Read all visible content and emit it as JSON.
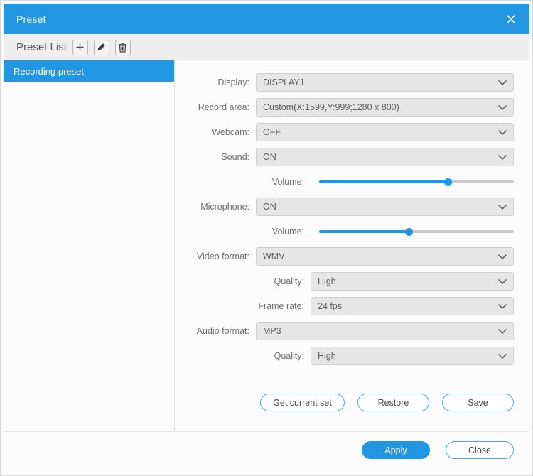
{
  "window": {
    "title": "Preset",
    "close_icon": "close-icon"
  },
  "list_header": {
    "title": "Preset List",
    "tools": [
      {
        "name": "add-preset-button",
        "icon": "plus-icon"
      },
      {
        "name": "edit-preset-button",
        "icon": "pencil-icon"
      },
      {
        "name": "delete-preset-button",
        "icon": "trash-icon"
      }
    ]
  },
  "sidebar": {
    "items": [
      {
        "label": "Recording preset",
        "selected": true
      }
    ]
  },
  "form": {
    "fields": [
      {
        "label": "Display:",
        "value": "DISPLAY1",
        "type": "select",
        "indent": false
      },
      {
        "label": "Record area:",
        "value": "Custom(X:1599,Y:999;1280 x 800)",
        "type": "select",
        "indent": false
      },
      {
        "label": "Webcam:",
        "value": "OFF",
        "type": "select",
        "indent": false
      },
      {
        "label": "Sound:",
        "value": "ON",
        "type": "select",
        "indent": false
      },
      {
        "label": "Volume:",
        "value": 66,
        "type": "slider",
        "indent": true
      },
      {
        "label": "Microphone:",
        "value": "ON",
        "type": "select",
        "indent": false
      },
      {
        "label": "Volume:",
        "value": 46,
        "type": "slider",
        "indent": true
      },
      {
        "label": "Video format:",
        "value": "WMV",
        "type": "select",
        "indent": false
      },
      {
        "label": "Quality:",
        "value": "High",
        "type": "select",
        "indent": true
      },
      {
        "label": "Frame rate:",
        "value": "24 fps",
        "type": "select",
        "indent": true
      },
      {
        "label": "Audio format:",
        "value": "MP3",
        "type": "select",
        "indent": false
      },
      {
        "label": "Quality:",
        "value": "High",
        "type": "select",
        "indent": true
      }
    ]
  },
  "mid_actions": {
    "get_current_set": "Get current set",
    "restore": "Restore",
    "save": "Save"
  },
  "footer": {
    "apply": "Apply",
    "close": "Close"
  },
  "colors": {
    "accent": "#2196e3",
    "select_bg": "#e6e6e6",
    "outline": "#4aa8e8"
  }
}
